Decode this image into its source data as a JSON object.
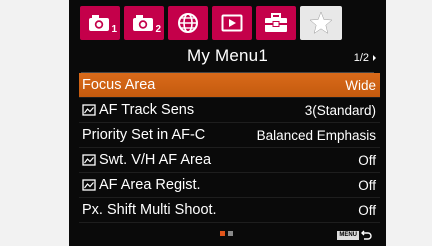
{
  "tabs": [
    {
      "icon": "camera-icon",
      "sub": "1",
      "active": false
    },
    {
      "icon": "camera-icon",
      "sub": "2",
      "active": false
    },
    {
      "icon": "globe-icon",
      "sub": "",
      "active": false
    },
    {
      "icon": "playback-icon",
      "sub": "",
      "active": false
    },
    {
      "icon": "toolbox-icon",
      "sub": "",
      "active": false
    },
    {
      "icon": "star-icon",
      "sub": "",
      "active": true
    }
  ],
  "menu": {
    "title": "My Menu1",
    "page_indicator": "1/2"
  },
  "items": [
    {
      "label": "Focus Area",
      "value": "Wide",
      "has_icon": false,
      "selected": true
    },
    {
      "label": "AF Track Sens",
      "value": "3(Standard)",
      "has_icon": true,
      "selected": false
    },
    {
      "label": "Priority Set in AF-C",
      "value": "Balanced Emphasis",
      "has_icon": false,
      "selected": false
    },
    {
      "label": "Swt. V/H AF Area",
      "value": "Off",
      "has_icon": true,
      "selected": false
    },
    {
      "label": "AF Area Regist.",
      "value": "Off",
      "has_icon": true,
      "selected": false
    },
    {
      "label": "Px. Shift Multi Shoot.",
      "value": "Off",
      "has_icon": false,
      "selected": false
    }
  ],
  "footer": {
    "page_dots": [
      "active",
      "inactive"
    ],
    "menu_badge": "MENU",
    "back_icon": "return-icon"
  },
  "colors": {
    "tab_bg": "#c4004a",
    "tab_active_bg": "#e8e8e8",
    "selected_row": "#d96a1a",
    "dot_active": "#e0541a",
    "dot_inactive": "#8a8a8a"
  }
}
